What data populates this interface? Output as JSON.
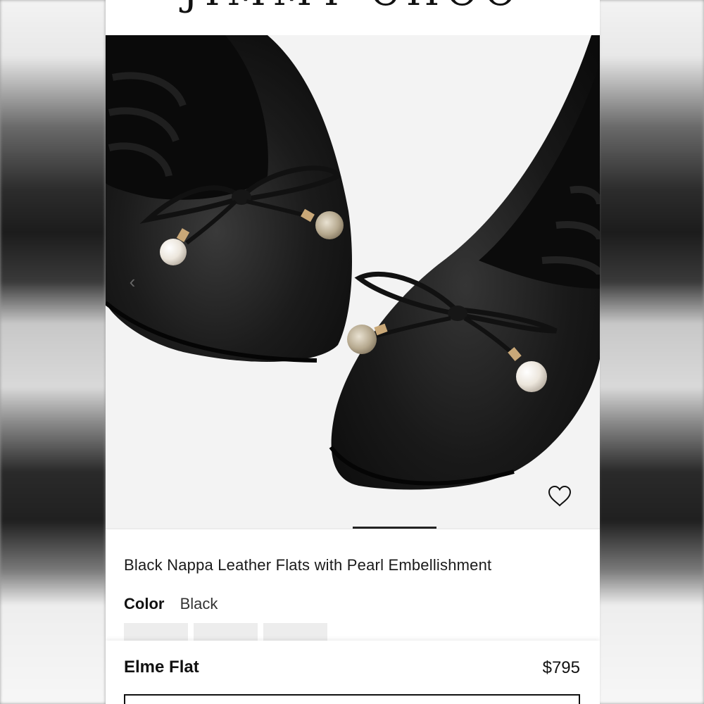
{
  "brand": {
    "logo_text": "JIMMY CHOO"
  },
  "gallery": {
    "prev_icon": "chevron-left-icon",
    "wishlist_icon": "heart-outline-icon",
    "progress": 0.17
  },
  "product": {
    "title": "Black Nappa Leather Flats with Pearl Embellishment",
    "color_label": "Color",
    "color_value": "Black",
    "swatch_count": 3
  },
  "sticky_bar": {
    "name": "Elme Flat",
    "price": "$795"
  },
  "colors": {
    "background": "#ffffff",
    "hero_bg": "#f3f3f3",
    "text": "#111111",
    "swatch": "#ededed"
  }
}
